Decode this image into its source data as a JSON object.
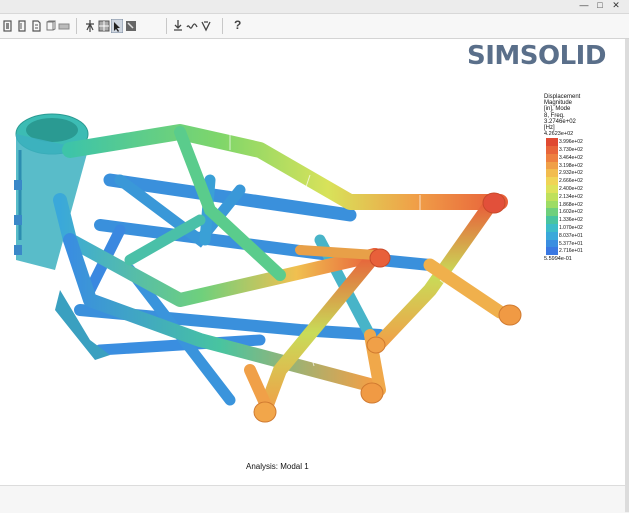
{
  "toolbar": {
    "tools": [
      "view-front-icon",
      "view-back-icon",
      "view-left-icon",
      "view-right-icon",
      "view-top-icon",
      "section-plane-icon",
      "grid-view-icon",
      "select-part-icon",
      "shaded-view-icon",
      "probe-icon",
      "animate-mode-icon",
      "deformation-icon"
    ],
    "help_label": "?"
  },
  "logo_text": "SIMSOLID",
  "legend": {
    "header_lines": [
      "Displacement",
      "Magnitude",
      "[in], Mode",
      "8, Freq.",
      "3.2746e+02",
      "[Hz]"
    ],
    "max_value": "4.2623e+02",
    "levels": [
      "3.996e+02",
      "3.730e+02",
      "3.464e+02",
      "3.198e+02",
      "2.932e+02",
      "2.666e+02",
      "2.400e+02",
      "2.134e+02",
      "1.868e+02",
      "1.602e+02",
      "1.336e+02",
      "1.070e+02",
      "8.037e+01",
      "5.377e+01",
      "2.716e+01"
    ],
    "min_value": "5.5994e-01",
    "colors": [
      "#e04a32",
      "#e8653a",
      "#ee8040",
      "#f0a048",
      "#f2bc4e",
      "#f0d456",
      "#dee25a",
      "#bfe05c",
      "#9ddc64",
      "#6fd07c",
      "#48c4a0",
      "#3cbcc8",
      "#3aa8da",
      "#3a8ee0",
      "#3a78e2"
    ]
  },
  "analysis_label": "Analysis: Modal 1"
}
